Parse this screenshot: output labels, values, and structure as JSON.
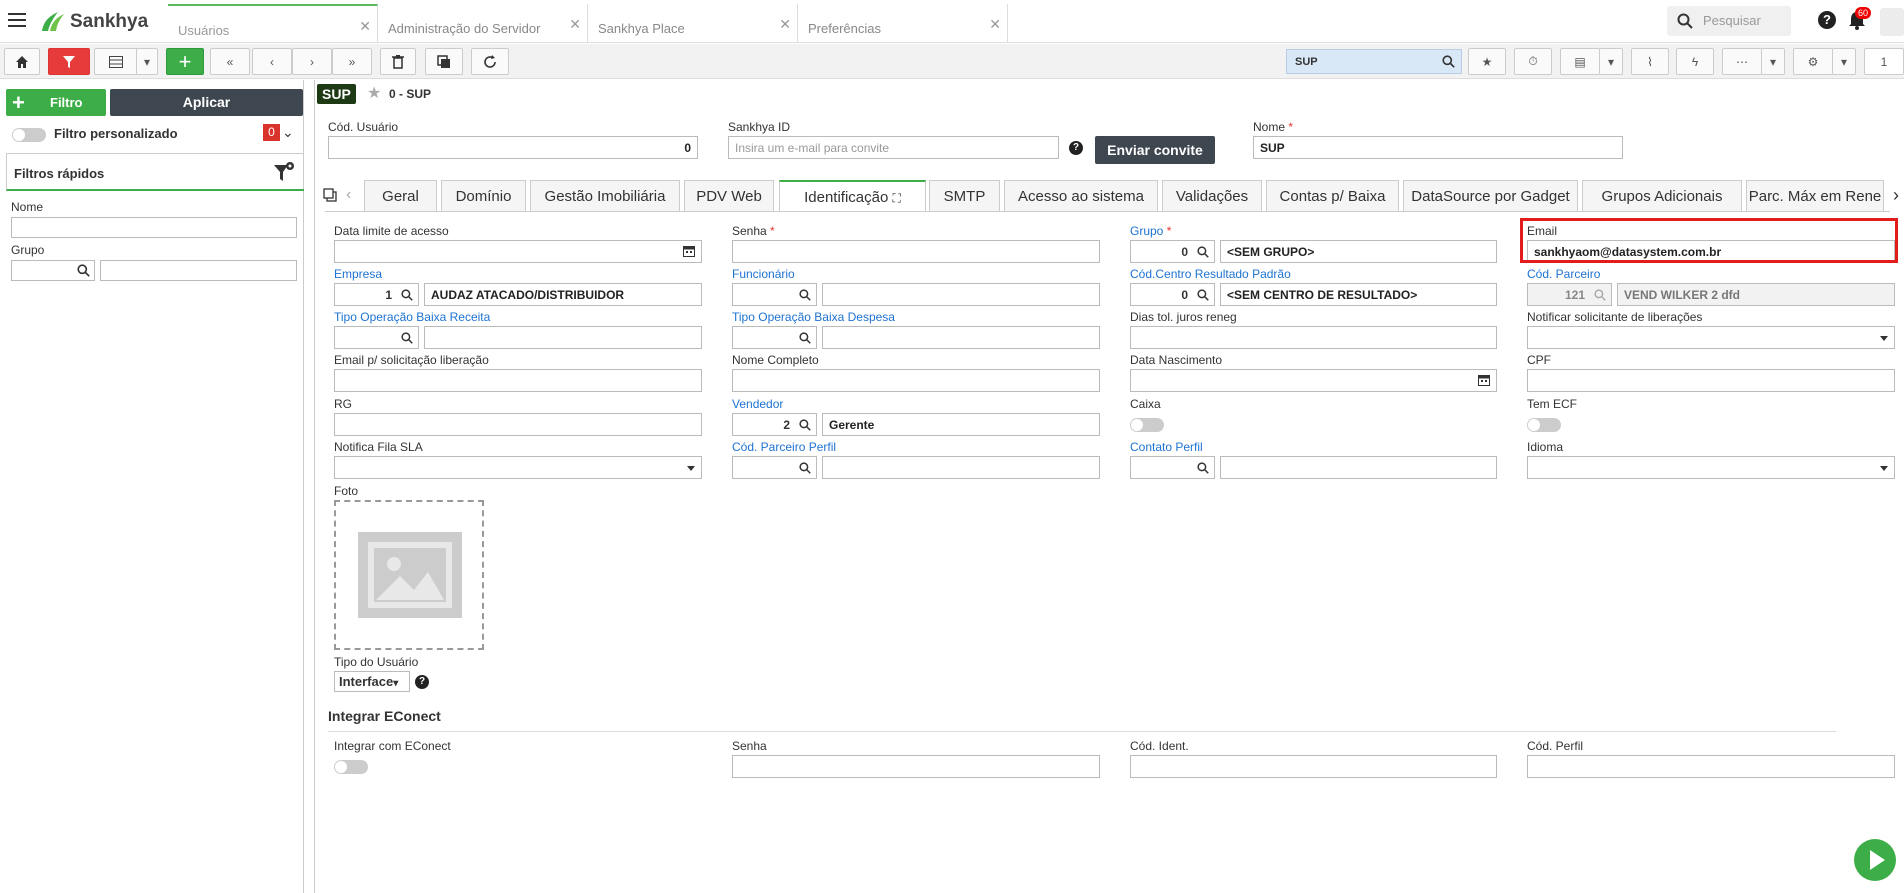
{
  "app": {
    "brand": "Sankhya"
  },
  "top_tabs": [
    {
      "label": "Usuários",
      "active": true
    },
    {
      "label": "Administração do Servidor"
    },
    {
      "label": "Sankhya Place"
    },
    {
      "label": "Preferências"
    }
  ],
  "top_search": {
    "placeholder": "Pesquisar"
  },
  "notifications": {
    "count": "60"
  },
  "toolbar": {
    "search_value": "SUP",
    "page": "1"
  },
  "left_panel": {
    "filter_button": "Filtro",
    "apply_button": "Aplicar",
    "custom_filter_label": "Filtro personalizado",
    "custom_filter_count": "0",
    "quick_filters_title": "Filtros rápidos",
    "fields": {
      "nome": "Nome",
      "grupo": "Grupo"
    }
  },
  "record": {
    "badge": "SUP",
    "breadcrumb": "0 - SUP"
  },
  "header_fields": {
    "cod_usuario": {
      "label": "Cód. Usuário",
      "value": "0"
    },
    "sankhya_id": {
      "label": "Sankhya ID",
      "placeholder": "Insira um e-mail para convite"
    },
    "invite_button": "Enviar convite",
    "nome": {
      "label": "Nome",
      "value": "SUP"
    }
  },
  "tabs": [
    "Geral",
    "Domínio",
    "Gestão Imobiliária",
    "PDV Web",
    "Identificação",
    "SMTP",
    "Acesso ao sistema",
    "Validações",
    "Contas p/ Baixa",
    "DataSource por Gadget",
    "Grupos Adicionais",
    "Parc. Máx em Rene"
  ],
  "form": {
    "data_limite": {
      "label": "Data limite de acesso"
    },
    "senha": {
      "label": "Senha"
    },
    "grupo": {
      "label": "Grupo",
      "code": "0",
      "desc": "<SEM GRUPO>"
    },
    "email": {
      "label": "Email",
      "value": "sankhyaom@datasystem.com.br"
    },
    "empresa": {
      "label": "Empresa",
      "code": "1",
      "desc": "AUDAZ ATACADO/DISTRIBUIDOR"
    },
    "funcionario": {
      "label": "Funcionário"
    },
    "cod_centro": {
      "label": "Cód.Centro Resultado Padrão",
      "code": "0",
      "desc": "<SEM CENTRO DE RESULTADO>"
    },
    "cod_parceiro": {
      "label": "Cód. Parceiro",
      "code": "121",
      "desc": "VEND WILKER 2 dfd"
    },
    "tipo_op_receita": {
      "label": "Tipo Operação Baixa Receita"
    },
    "tipo_op_despesa": {
      "label": "Tipo Operação Baixa Despesa"
    },
    "dias_tol": {
      "label": "Dias tol. juros reneg"
    },
    "notificar_solic": {
      "label": "Notificar solicitante de liberações"
    },
    "email_solic": {
      "label": "Email p/ solicitação liberação"
    },
    "nome_completo": {
      "label": "Nome Completo"
    },
    "data_nasc": {
      "label": "Data Nascimento"
    },
    "cpf": {
      "label": "CPF"
    },
    "rg": {
      "label": "RG"
    },
    "vendedor": {
      "label": "Vendedor",
      "code": "2",
      "desc": "Gerente"
    },
    "caixa": {
      "label": "Caixa"
    },
    "tem_ecf": {
      "label": "Tem ECF"
    },
    "notifica_fila": {
      "label": "Notifica Fila SLA"
    },
    "cod_parc_perfil": {
      "label": "Cód. Parceiro Perfil"
    },
    "contato_perfil": {
      "label": "Contato Perfil"
    },
    "idioma": {
      "label": "Idioma"
    },
    "foto": {
      "label": "Foto"
    },
    "tipo_usuario": {
      "label": "Tipo do Usuário",
      "value": "Interface"
    }
  },
  "econect": {
    "title": "Integrar EConect",
    "integrar": "Integrar com EConect",
    "senha": "Senha",
    "cod_ident": "Cód. Ident.",
    "cod_perfil": "Cód. Perfil"
  },
  "colors": {
    "accent": "#3dae47",
    "dark_button": "#3e4650",
    "link": "#1e73d2",
    "highlight": "#e21b1b"
  }
}
